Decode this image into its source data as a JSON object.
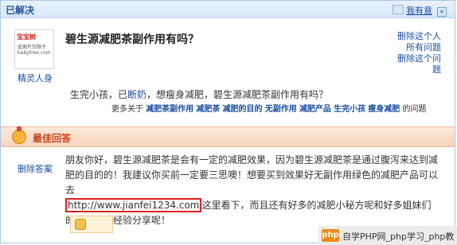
{
  "header": {
    "title": "已解决",
    "compete_label": "我有意",
    "close_label": "×"
  },
  "avatar": {
    "brand_prefix": "宝宝树",
    "brand_main": "宝宝树",
    "body_text": "此图片仅限于 babytree.com",
    "user_name": "精灵人身"
  },
  "question": {
    "title": "碧生源减肥茶副作用有吗？",
    "body_pre": "生完小孩，已",
    "body_link": "断奶",
    "body_post": "，想瘦身减肥，碧生源减肥茶副作用有吗？",
    "more_prefix": "更多关于",
    "keywords": [
      "减肥茶副作用",
      "减肥茶",
      "减肥的目的",
      "无副作用",
      "减肥产品",
      "生完小孩",
      "瘦身减肥"
    ],
    "more_suffix": "的问题"
  },
  "side_links": [
    "删除这个人",
    "所有问题",
    "删除这个问",
    "题"
  ],
  "best_answer": {
    "title": "最佳回答",
    "side_label": "删除答案",
    "text_before": "朋友你好，碧生源减肥茶是会有一定的减肥效果，因为碧生源减肥茶是通过腹泻来达到减肥的目的的！我建议你买前一定要三思噢！想要买到效果好无副作用绿色的减肥产品可以去",
    "url": "http://www.jianfei1234.com",
    "text_after": "这里看下，而且还有好多的减肥小秘方呢和好多姐妹们的减肥成功经验分享呢！"
  },
  "watermark": {
    "logo": "php",
    "text": "自学PHP网_php学习_php教"
  }
}
